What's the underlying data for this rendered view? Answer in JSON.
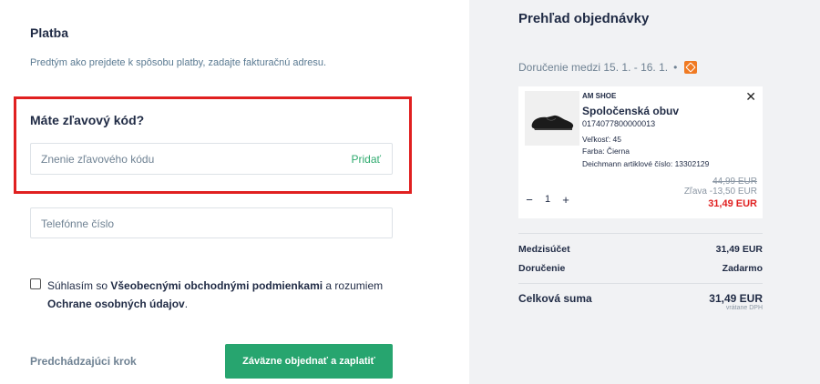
{
  "payment": {
    "title": "Platba",
    "description": "Predtým ako prejdete k spôsobu platby, zadajte fakturačnú adresu."
  },
  "discount": {
    "title": "Máte zľavový kód?",
    "placeholder": "Znenie zľavového kódu",
    "apply_label": "Pridať"
  },
  "phone": {
    "placeholder": "Telefónne číslo"
  },
  "consent": {
    "prefix": "Súhlasím so ",
    "terms_link": "Všeobecnými obchodnými podmienkami",
    "middle": " a rozumiem",
    "privacy_link": "Ochrane osobných údajov",
    "suffix": ".",
    "checked": false
  },
  "actions": {
    "back_label": "Predchádzajúci krok",
    "submit_label": "Záväzne objednať a zaplatiť"
  },
  "summary": {
    "title": "Prehľad objednávky",
    "delivery_text": "Doručenie medzi 15. 1. - 16. 1.",
    "delivery_dot": "•",
    "carrier_icon": "dpd-icon",
    "product": {
      "brand": "AM SHOE",
      "name": "Spoločenská obuv",
      "sku": "0174077800000013",
      "size": "Veľkosť: 45",
      "color": "Farba: Čierna",
      "article": "Deichmann artiklové číslo: 13302129",
      "price_old": "44,99 EUR",
      "discount_label": "Zľava",
      "discount_value": "-13,50 EUR",
      "price_new": "31,49 EUR",
      "quantity": "1",
      "minus": "−",
      "plus": "+",
      "close": "✕"
    },
    "subtotal_label": "Medzisúčet",
    "subtotal_value": "31,49 EUR",
    "shipping_label": "Doručenie",
    "shipping_value": "Zadarmo",
    "total_label": "Celková suma",
    "total_value": "31,49 EUR",
    "vat_note": "vrátane DPH"
  },
  "colors": {
    "accent_green": "#27a56f",
    "highlight_red": "#e02020",
    "carrier_orange": "#f07a22"
  }
}
